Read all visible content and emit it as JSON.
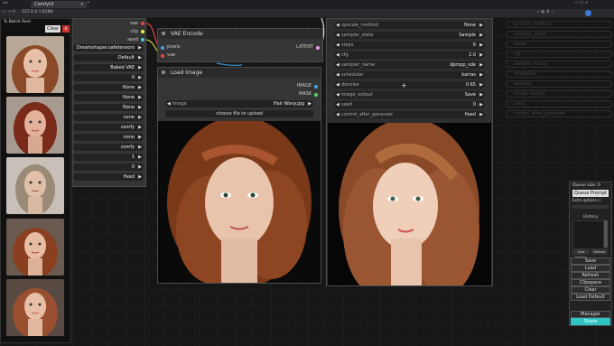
{
  "browser": {
    "tab_title": "ComfyUI",
    "url": "127.0.0.1:8188"
  },
  "left_panel": {
    "title": "% Batch Reel",
    "clear_label": "Clear",
    "close_label": "x"
  },
  "checkpoint_node": {
    "outputs": [
      "vae",
      "clip",
      "seed"
    ],
    "values": [
      "Dreamshaper.safetensors",
      "Default",
      "Baked VAE",
      "0",
      "None",
      "None",
      "None",
      "none",
      "comfy",
      "none",
      "comfy",
      "1",
      "0",
      "fixed"
    ]
  },
  "vae_encode": {
    "title": "VAE Encode",
    "inputs": [
      "pixels",
      "vae"
    ],
    "output": "LATENT"
  },
  "load_image": {
    "title": "Load Image",
    "outputs": [
      "IMAGE",
      "MASK"
    ],
    "image_label": "image",
    "image_value": "Hair Wavy.jpg",
    "upload_label": "choose file to upload"
  },
  "sampler": {
    "rows": [
      {
        "label": "upscale_method",
        "value": "None"
      },
      {
        "label": "sampler_state",
        "value": "Sample"
      },
      {
        "label": "steps",
        "value": "6"
      },
      {
        "label": "cfg",
        "value": "2.0"
      },
      {
        "label": "sampler_name",
        "value": "dpmpp_sde"
      },
      {
        "label": "scheduler",
        "value": "karras"
      },
      {
        "label": "denoise",
        "value": "0.65"
      },
      {
        "label": "image_output",
        "value": "Save"
      },
      {
        "label": "seed",
        "value": "0"
      },
      {
        "label": "control_after_generate",
        "value": "fixed"
      }
    ]
  },
  "ghost_rows": [
    "upscale_method",
    "sampler_state",
    "steps",
    "cfg",
    "sampler_name",
    "scheduler",
    "denoise",
    "image_output",
    "seed",
    "control_after_generate"
  ],
  "sidebar": {
    "queue_size": "Queue size: 0",
    "queue_prompt": "Queue Prompt",
    "extra_options": "Extra options",
    "history": "History",
    "view_history": "View History",
    "refresh_small": "Refresh",
    "buttons": [
      "Save",
      "Load",
      "Refresh",
      "Clipspace",
      "Clear",
      "Load Default"
    ],
    "manager": "Manager",
    "share": "Share"
  },
  "colors": {
    "accent": "#3aa0ff",
    "share": "#2ec4c4"
  }
}
